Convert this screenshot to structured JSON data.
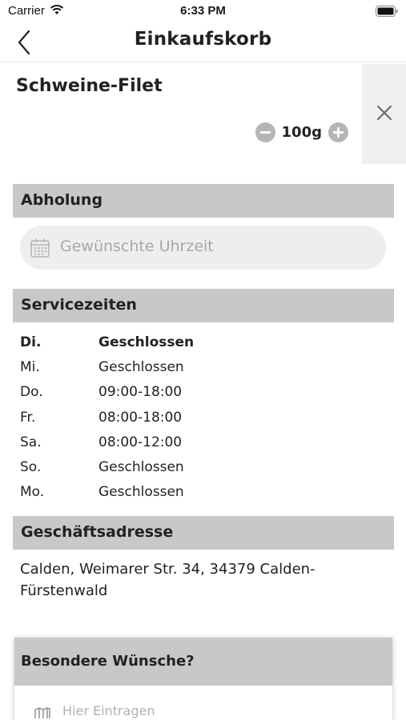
{
  "status_bar": {
    "carrier": "Carrier",
    "time": "6:33 PM"
  },
  "nav": {
    "title": "Einkaufskorb"
  },
  "cart_item": {
    "name": "Schweine-Filet",
    "quantity": "100g"
  },
  "pickup": {
    "header": "Abholung",
    "time_placeholder": "Gewünschte Uhrzeit"
  },
  "service_hours": {
    "header": "Servicezeiten",
    "rows": [
      {
        "day": "Di.",
        "hours": "Geschlossen"
      },
      {
        "day": "Mi.",
        "hours": "Geschlossen"
      },
      {
        "day": "Do.",
        "hours": "09:00-18:00"
      },
      {
        "day": "Fr.",
        "hours": "08:00-18:00"
      },
      {
        "day": "Sa.",
        "hours": "08:00-12:00"
      },
      {
        "day": "So.",
        "hours": "Geschlossen"
      },
      {
        "day": "Mo.",
        "hours": "Geschlossen"
      }
    ]
  },
  "address": {
    "header": "Geschäftsadresse",
    "text": "Calden, Weimarer Str. 34, 34379 Calden-Fürstenwald"
  },
  "wishes": {
    "header": "Besondere Wünsche?",
    "placeholder": "Hier Eintragen"
  },
  "colors": {
    "section_header_bg": "#c8c8c8",
    "remove_area_bg": "#f0f0f0",
    "input_bg": "#eeeeee",
    "placeholder": "#a8a8a8"
  }
}
